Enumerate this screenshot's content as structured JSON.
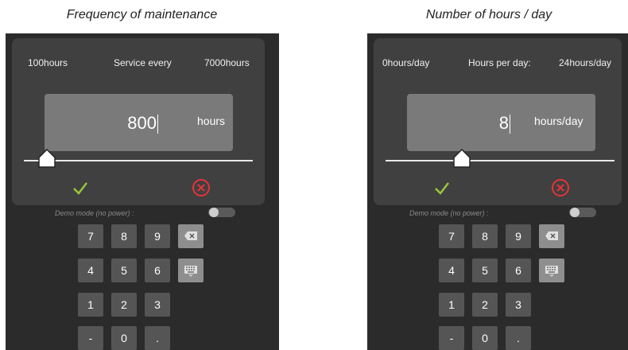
{
  "left": {
    "caption": "Frequency of maintenance",
    "range_min": "100hours",
    "range_label": "Service every",
    "range_max": "7000hours",
    "value": "800",
    "unit": "hours",
    "slider_fraction": 0.102,
    "demo_label": "Demo mode (no power) :"
  },
  "right": {
    "caption": "Number of hours / day",
    "range_min": "0hours/day",
    "range_label": "Hours per day:",
    "range_max": "24hours/day",
    "value": "8",
    "unit": "hours/day",
    "slider_fraction": 0.333,
    "demo_label": "Demo mode (no power) :"
  },
  "keypad": {
    "rows": [
      [
        "7",
        "8",
        "9",
        "backspace-icon"
      ],
      [
        "4",
        "5",
        "6",
        "keyboard-icon"
      ],
      [
        "1",
        "2",
        "3",
        ""
      ],
      [
        "-",
        "0",
        ".",
        ""
      ]
    ]
  },
  "colors": {
    "panel": "#2b2b2b",
    "card": "#404040",
    "input": "#7a7a7a",
    "confirm": "#9bc53d",
    "cancel": "#e8323a"
  }
}
